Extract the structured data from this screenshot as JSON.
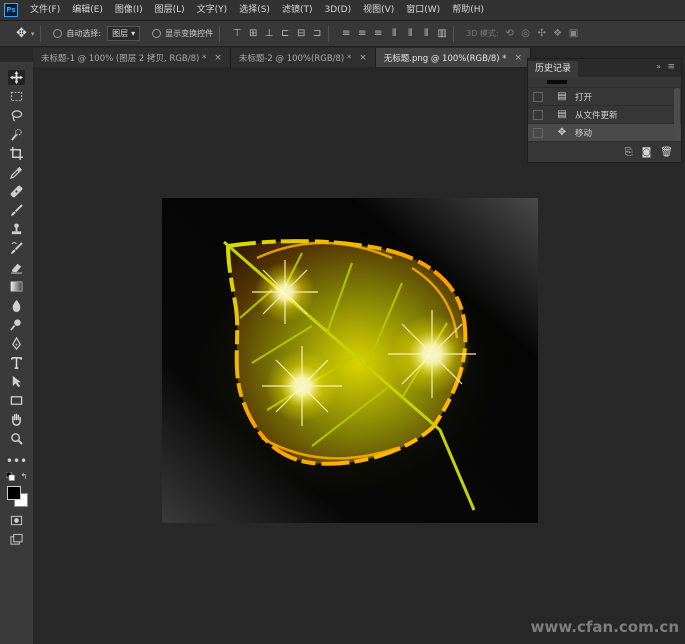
{
  "app": {
    "logo_text": "Ps"
  },
  "menu": [
    "文件(F)",
    "编辑(E)",
    "图像(I)",
    "图层(L)",
    "文字(Y)",
    "选择(S)",
    "滤镜(T)",
    "3D(D)",
    "视图(V)",
    "窗口(W)",
    "帮助(H)"
  ],
  "options": {
    "auto_select_label": "自动选择:",
    "auto_select_value": "图层",
    "show_transform_label": "显示变换控件",
    "mode_3d_label": "3D 模式:"
  },
  "tabs": [
    {
      "label": "未标题-1 @ 100% (图层 2 拷贝, RGB/8) *",
      "active": false
    },
    {
      "label": "未标题-2 @ 100%(RGB/8) *",
      "active": false
    },
    {
      "label": "无标题.png @ 100%(RGB/8) *",
      "active": true
    }
  ],
  "history_panel": {
    "title": "历史记录",
    "items": [
      {
        "label": "打开",
        "icon": "document-icon"
      },
      {
        "label": "从文件更新",
        "icon": "document-icon"
      },
      {
        "label": "移动",
        "icon": "move-icon"
      }
    ]
  },
  "watermark": "www.cfan.com.cn",
  "colors": {
    "accent": "#31a8ff",
    "panel": "#363636",
    "workspace": "#282828"
  }
}
